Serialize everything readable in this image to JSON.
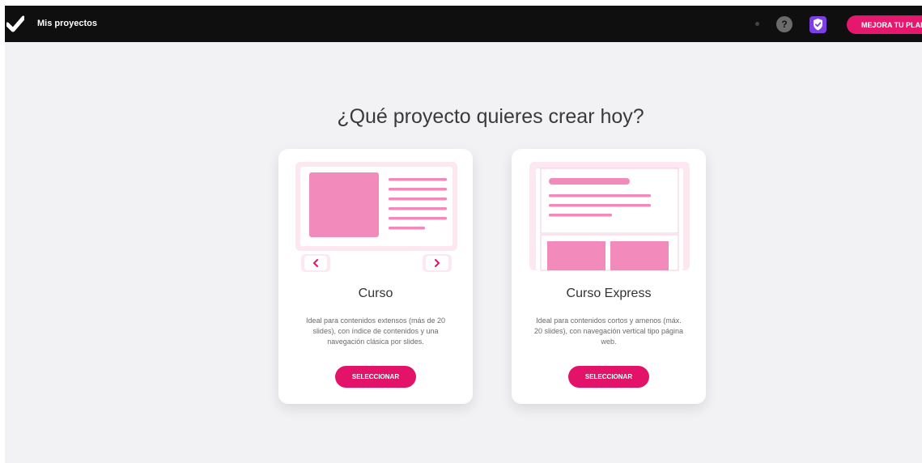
{
  "topbar": {
    "title": "Mis proyectos",
    "help_label": "?",
    "upgrade_label": "MEJORA TU PLAN"
  },
  "main": {
    "heading": "¿Qué proyecto quieres crear hoy?"
  },
  "cards": [
    {
      "title": "Curso",
      "description": "Ideal para contenidos extensos (más de 20 slides), con índice de contenidos y una navegación clásica por slides.",
      "button_label": "SELECCIONAR"
    },
    {
      "title": "Curso Express",
      "description": "Ideal para contenidos cortos y amenos (máx. 20 slides), con navegación vertical tipo página web.",
      "button_label": "SELECCIONAR"
    }
  ],
  "colors": {
    "accent": "#e4136a",
    "illustration_pink": "#f28bbc",
    "topbar": "#0f0f0f",
    "background": "#f2f2f4"
  },
  "icons": [
    "checkmark-logo-icon",
    "help-icon",
    "shield-check-icon",
    "chevron-left-icon",
    "chevron-right-icon"
  ]
}
